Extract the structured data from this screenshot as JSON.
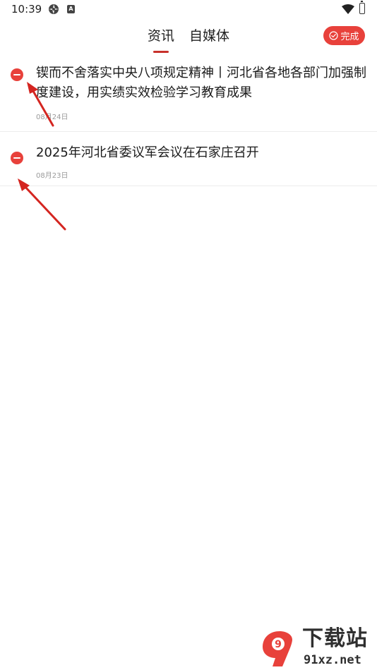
{
  "status_bar": {
    "time": "10:39",
    "a_badge": "A"
  },
  "header": {
    "tabs": [
      {
        "label": "资讯",
        "active": true
      },
      {
        "label": "自媒体",
        "active": false
      }
    ],
    "done_label": "完成"
  },
  "news": [
    {
      "title": "锲而不舍落实中央八项规定精神丨河北省各地各部门加强制度建设，用实绩实效检验学习教育成果",
      "date": "08月24日"
    },
    {
      "title": "2025年河北省委议军会议在石家庄召开",
      "date": "08月23日"
    }
  ],
  "watermark": {
    "logo_text": "9",
    "text": "下载站",
    "url": "91xz.net"
  },
  "colors": {
    "accent": "#e8413b",
    "tab_indicator": "#c8312b",
    "date": "#9a9a9a"
  }
}
